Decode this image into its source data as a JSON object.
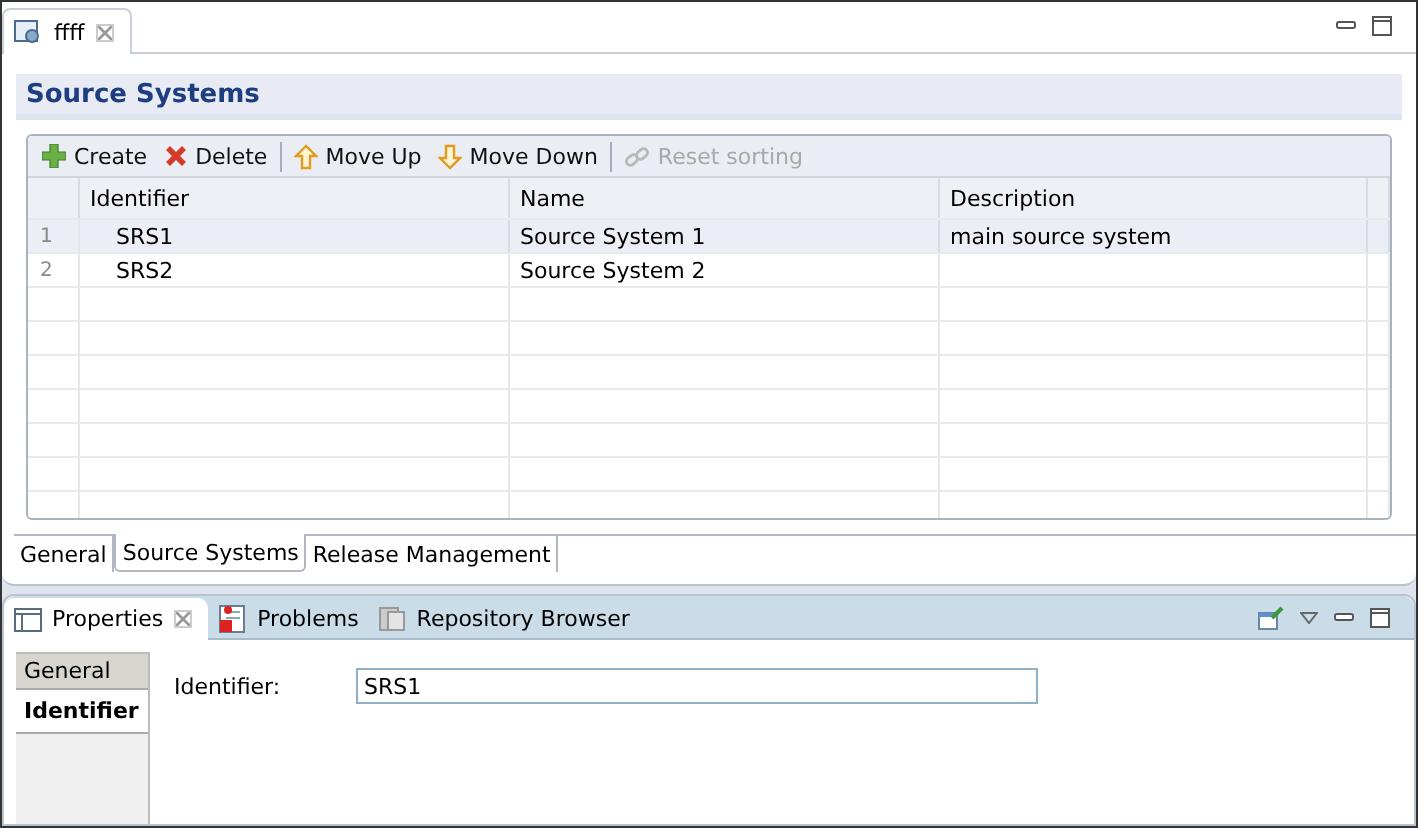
{
  "editor": {
    "tab": {
      "title": "ffff",
      "selected": true
    },
    "title": "Source Systems",
    "toolbar": [
      {
        "kind": "create",
        "label": "Create",
        "disabled": false
      },
      {
        "kind": "delete",
        "label": "Delete",
        "disabled": false
      },
      {
        "kind": "up",
        "label": "Move Up",
        "disabled": false
      },
      {
        "kind": "down",
        "label": "Move Down",
        "disabled": false
      },
      {
        "kind": "reset",
        "label": "Reset sorting",
        "disabled": true
      }
    ],
    "table": {
      "columns": [
        "Identifier",
        "Name",
        "Description"
      ],
      "rows": [
        {
          "number": "1",
          "identifier": "SRS1",
          "name": "Source System 1",
          "description": "main source system",
          "selected": true
        },
        {
          "number": "2",
          "identifier": "SRS2",
          "name": "Source System 2",
          "description": "",
          "selected": false
        }
      ]
    },
    "page_tabs": [
      {
        "label": "General",
        "selected": false
      },
      {
        "label": "Source Systems",
        "selected": true
      },
      {
        "label": "Release Management",
        "selected": false
      }
    ]
  },
  "properties_view": {
    "tabs": [
      {
        "kind": "properties",
        "label": "Properties",
        "selected": true
      },
      {
        "kind": "problems",
        "label": "Problems",
        "selected": false
      },
      {
        "kind": "repository",
        "label": "Repository Browser",
        "selected": false
      }
    ],
    "sidebar": [
      {
        "label": "General",
        "selected": false
      },
      {
        "label": "Identifier",
        "selected": true
      }
    ],
    "field": {
      "label": "Identifier:",
      "value": "SRS1"
    }
  }
}
